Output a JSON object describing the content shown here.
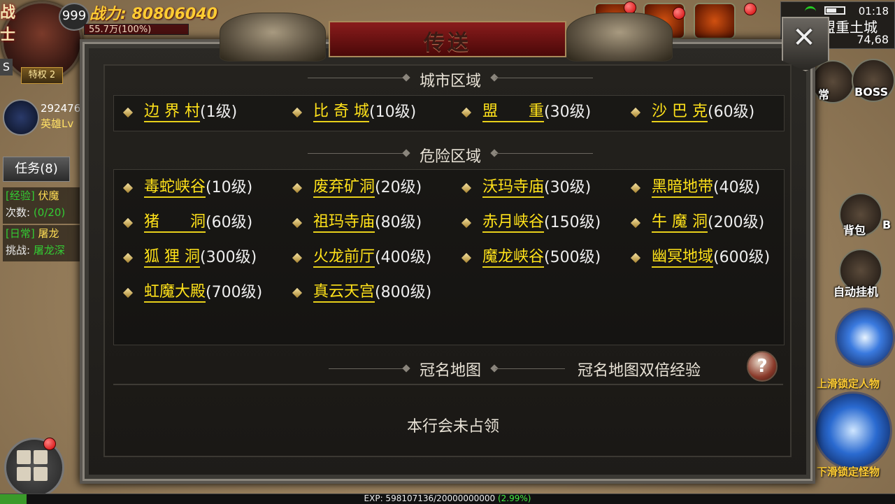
{
  "hud": {
    "class_glyph": "战士",
    "level": "999",
    "power": "战力: 80806040",
    "hp": "55.7万(100%)",
    "privilege": "特权 2",
    "s_label": "S",
    "hero_num": "292476",
    "hero_lv": "英雄Lv",
    "task_tab": "任务(8)",
    "quest1": {
      "tag": "[经验]",
      "name": "伏魔",
      "sub_label": "次数:",
      "sub_val": "(0/20)"
    },
    "quest2": {
      "tag": "[日常]",
      "name": "屠龙",
      "sub_label": "挑战:",
      "sub_val": "屠龙深"
    },
    "side": {
      "daily": "常",
      "boss": "BOSS",
      "bag": "背包",
      "b": "B",
      "auto": "自动挂机"
    },
    "skill1": "上滑锁定人物",
    "skill2": "下滑锁定怪物",
    "status": {
      "time": "01:18",
      "map": "盟重土城",
      "coords": "74,68",
      "battery_level": 0.6
    }
  },
  "exp": {
    "text": "EXP: 598107136/20000000000 ",
    "pct": "(2.99%)",
    "fraction": 0.0299
  },
  "dialog": {
    "title": "传送",
    "close": "✕",
    "city": {
      "title": "城市区域",
      "items": [
        {
          "name": "边 界 村",
          "level": "(1级)"
        },
        {
          "name": "比 奇 城",
          "level": "(10级)"
        },
        {
          "name": "盟　　重",
          "level": "(30级)"
        },
        {
          "name": "沙 巴 克",
          "level": "(60级)"
        }
      ]
    },
    "danger": {
      "title": "危险区域",
      "items": [
        {
          "name": "毒蛇峡谷",
          "level": "(10级)"
        },
        {
          "name": "废弃矿洞",
          "level": "(20级)"
        },
        {
          "name": "沃玛寺庙",
          "level": "(30级)"
        },
        {
          "name": "黑暗地带",
          "level": "(40级)"
        },
        {
          "name": "猪　　洞",
          "level": "(60级)"
        },
        {
          "name": "祖玛寺庙",
          "level": "(80级)"
        },
        {
          "name": "赤月峡谷",
          "level": "(150级)"
        },
        {
          "name": "牛 魔 洞",
          "level": "(200级)"
        },
        {
          "name": "狐 狸 洞",
          "level": "(300级)"
        },
        {
          "name": "火龙前厅",
          "level": "(400级)"
        },
        {
          "name": "魔龙峡谷",
          "level": "(500级)"
        },
        {
          "name": "幽冥地域",
          "level": "(600级)"
        },
        {
          "name": "虹魔大殿",
          "level": "(700级)"
        },
        {
          "name": "真云天宫",
          "level": "(800级)"
        }
      ]
    },
    "named": {
      "title": "冠名地图",
      "double_exp": "冠名地图双倍经验",
      "help": "?",
      "status": "本行会未占领"
    }
  }
}
